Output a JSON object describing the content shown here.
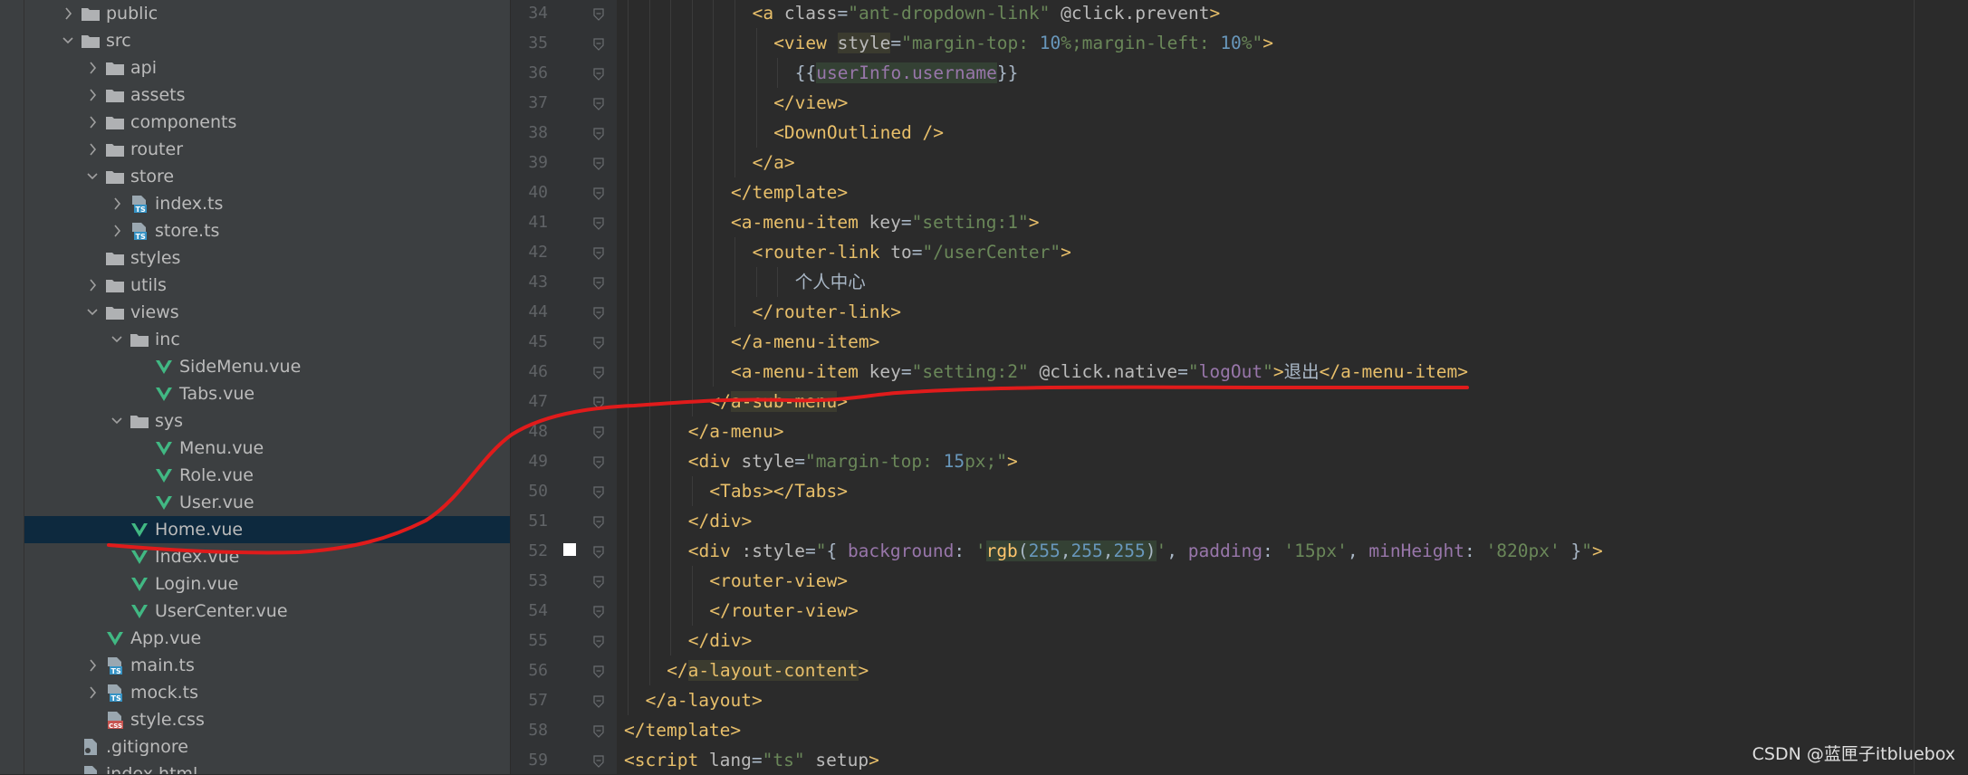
{
  "project_tree": {
    "items": [
      {
        "label": "public",
        "type": "folder",
        "depth": 0,
        "expanded": false,
        "selected": false
      },
      {
        "label": "src",
        "type": "folder",
        "depth": 0,
        "expanded": true,
        "selected": false
      },
      {
        "label": "api",
        "type": "folder",
        "depth": 1,
        "expanded": false,
        "selected": false
      },
      {
        "label": "assets",
        "type": "folder",
        "depth": 1,
        "expanded": false,
        "selected": false
      },
      {
        "label": "components",
        "type": "folder",
        "depth": 1,
        "expanded": false,
        "selected": false
      },
      {
        "label": "router",
        "type": "folder",
        "depth": 1,
        "expanded": false,
        "selected": false
      },
      {
        "label": "store",
        "type": "folder",
        "depth": 1,
        "expanded": true,
        "selected": false
      },
      {
        "label": "index.ts",
        "type": "ts",
        "depth": 2,
        "expanded": false,
        "selected": false
      },
      {
        "label": "store.ts",
        "type": "ts",
        "depth": 2,
        "expanded": false,
        "selected": false
      },
      {
        "label": "styles",
        "type": "folder",
        "depth": 1,
        "expanded": null,
        "selected": false
      },
      {
        "label": "utils",
        "type": "folder",
        "depth": 1,
        "expanded": false,
        "selected": false
      },
      {
        "label": "views",
        "type": "folder",
        "depth": 1,
        "expanded": true,
        "selected": false
      },
      {
        "label": "inc",
        "type": "folder",
        "depth": 2,
        "expanded": true,
        "selected": false
      },
      {
        "label": "SideMenu.vue",
        "type": "vue",
        "depth": 3,
        "expanded": null,
        "selected": false
      },
      {
        "label": "Tabs.vue",
        "type": "vue",
        "depth": 3,
        "expanded": null,
        "selected": false
      },
      {
        "label": "sys",
        "type": "folder",
        "depth": 2,
        "expanded": true,
        "selected": false
      },
      {
        "label": "Menu.vue",
        "type": "vue",
        "depth": 3,
        "expanded": null,
        "selected": false
      },
      {
        "label": "Role.vue",
        "type": "vue",
        "depth": 3,
        "expanded": null,
        "selected": false
      },
      {
        "label": "User.vue",
        "type": "vue",
        "depth": 3,
        "expanded": null,
        "selected": false
      },
      {
        "label": "Home.vue",
        "type": "vue",
        "depth": 2,
        "expanded": null,
        "selected": true
      },
      {
        "label": "Index.vue",
        "type": "vue",
        "depth": 2,
        "expanded": null,
        "selected": false
      },
      {
        "label": "Login.vue",
        "type": "vue",
        "depth": 2,
        "expanded": null,
        "selected": false
      },
      {
        "label": "UserCenter.vue",
        "type": "vue",
        "depth": 2,
        "expanded": null,
        "selected": false
      },
      {
        "label": "App.vue",
        "type": "vue",
        "depth": 1,
        "expanded": null,
        "selected": false
      },
      {
        "label": "main.ts",
        "type": "ts",
        "depth": 1,
        "expanded": false,
        "selected": false
      },
      {
        "label": "mock.ts",
        "type": "ts",
        "depth": 1,
        "expanded": false,
        "selected": false
      },
      {
        "label": "style.css",
        "type": "css",
        "depth": 1,
        "expanded": null,
        "selected": false
      },
      {
        "label": ".gitignore",
        "type": "git",
        "depth": 0,
        "expanded": null,
        "selected": false
      },
      {
        "label": "index.html",
        "type": "html",
        "depth": 0,
        "expanded": null,
        "selected": false
      }
    ]
  },
  "editor": {
    "lines": [
      {
        "n": "34",
        "indent": 6,
        "tokens": [
          [
            "t",
            "<a "
          ],
          [
            "a",
            "class"
          ],
          [
            "p",
            "="
          ],
          [
            "s",
            "\"ant-dropdown-link\""
          ],
          [
            "p",
            " "
          ],
          [
            "a",
            "@click.prevent"
          ],
          [
            "t",
            ">"
          ]
        ]
      },
      {
        "n": "35",
        "indent": 7,
        "tokens": [
          [
            "t",
            "<view "
          ],
          [
            "ah",
            "style"
          ],
          [
            "p",
            "="
          ],
          [
            "s",
            "\"margin-top: "
          ],
          [
            "num",
            "10"
          ],
          [
            "s",
            "%;margin-left: "
          ],
          [
            "num",
            "10"
          ],
          [
            "s",
            "%\""
          ],
          [
            "t",
            ">"
          ]
        ]
      },
      {
        "n": "36",
        "indent": 8,
        "tokens": [
          [
            "p",
            "{{"
          ],
          [
            "var",
            "userInfo.username"
          ],
          [
            "p",
            "}}"
          ]
        ]
      },
      {
        "n": "37",
        "indent": 7,
        "tokens": [
          [
            "t",
            "</view>"
          ]
        ]
      },
      {
        "n": "38",
        "indent": 7,
        "tokens": [
          [
            "t",
            "<DownOutlined />"
          ]
        ]
      },
      {
        "n": "39",
        "indent": 6,
        "tokens": [
          [
            "t",
            "</a>"
          ]
        ]
      },
      {
        "n": "40",
        "indent": 5,
        "tokens": [
          [
            "t",
            "</template>"
          ]
        ]
      },
      {
        "n": "41",
        "indent": 5,
        "tokens": [
          [
            "t",
            "<a-menu-item "
          ],
          [
            "a",
            "key"
          ],
          [
            "p",
            "="
          ],
          [
            "s",
            "\"setting:1\""
          ],
          [
            "t",
            ">"
          ]
        ]
      },
      {
        "n": "42",
        "indent": 6,
        "tokens": [
          [
            "t",
            "<router-link "
          ],
          [
            "a",
            "to"
          ],
          [
            "p",
            "="
          ],
          [
            "s",
            "\"/userCenter\""
          ],
          [
            "t",
            ">"
          ]
        ]
      },
      {
        "n": "43",
        "indent": 8,
        "tokens": [
          [
            "p",
            "个人中心"
          ]
        ]
      },
      {
        "n": "44",
        "indent": 6,
        "tokens": [
          [
            "t",
            "</router-link>"
          ]
        ]
      },
      {
        "n": "45",
        "indent": 5,
        "tokens": [
          [
            "t",
            "</a-menu-item>"
          ]
        ]
      },
      {
        "n": "46",
        "indent": 5,
        "tokens": [
          [
            "t",
            "<a-menu-item "
          ],
          [
            "a",
            "key"
          ],
          [
            "p",
            "="
          ],
          [
            "s",
            "\"setting:2\""
          ],
          [
            "p",
            " "
          ],
          [
            "a",
            "@click.native"
          ],
          [
            "p",
            "="
          ],
          [
            "s",
            "\""
          ],
          [
            "var",
            "logOut"
          ],
          [
            "s",
            "\""
          ],
          [
            "t",
            ">"
          ],
          [
            "p",
            "退出"
          ],
          [
            "t",
            "</a-menu-item>"
          ]
        ]
      },
      {
        "n": "47",
        "indent": 4,
        "tokens": [
          [
            "t",
            "</"
          ],
          [
            "th",
            "a-sub-menu"
          ],
          [
            "t",
            ">"
          ]
        ]
      },
      {
        "n": "48",
        "indent": 3,
        "tokens": [
          [
            "t",
            "</a-menu>"
          ]
        ]
      },
      {
        "n": "49",
        "indent": 3,
        "tokens": [
          [
            "t",
            "<div "
          ],
          [
            "a",
            "style"
          ],
          [
            "p",
            "="
          ],
          [
            "s",
            "\"margin-top: "
          ],
          [
            "num",
            "15"
          ],
          [
            "s",
            "px;\""
          ],
          [
            "t",
            ">"
          ]
        ]
      },
      {
        "n": "50",
        "indent": 4,
        "tokens": [
          [
            "t",
            "<Tabs></Tabs>"
          ]
        ]
      },
      {
        "n": "51",
        "indent": 3,
        "tokens": [
          [
            "t",
            "</div>"
          ]
        ]
      },
      {
        "n": "52",
        "indent": 3,
        "tokens": [
          [
            "t",
            "<div "
          ],
          [
            "a",
            ":style"
          ],
          [
            "p",
            "="
          ],
          [
            "s",
            "\""
          ],
          [
            "p",
            "{ "
          ],
          [
            "var",
            "background"
          ],
          [
            "p",
            ": "
          ],
          [
            "s",
            "'"
          ],
          [
            "fnh",
            "rgb"
          ],
          [
            "ph",
            "("
          ],
          [
            "numh",
            "255"
          ],
          [
            "ph",
            ","
          ],
          [
            "numh",
            "255"
          ],
          [
            "ph",
            ","
          ],
          [
            "numh",
            "255"
          ],
          [
            "ph",
            ")"
          ],
          [
            "s",
            "'"
          ],
          [
            "p",
            ", "
          ],
          [
            "var",
            "padding"
          ],
          [
            "p",
            ": "
          ],
          [
            "s",
            "'15px'"
          ],
          [
            "p",
            ", "
          ],
          [
            "var",
            "minHeight"
          ],
          [
            "p",
            ": "
          ],
          [
            "s",
            "'820px'"
          ],
          [
            "p",
            " }"
          ],
          [
            "s",
            "\""
          ],
          [
            "t",
            ">"
          ]
        ]
      },
      {
        "n": "53",
        "indent": 4,
        "tokens": [
          [
            "t",
            "<router-view>"
          ]
        ]
      },
      {
        "n": "54",
        "indent": 4,
        "tokens": [
          [
            "t",
            "</router-view>"
          ]
        ]
      },
      {
        "n": "55",
        "indent": 3,
        "tokens": [
          [
            "t",
            "</div>"
          ]
        ]
      },
      {
        "n": "56",
        "indent": 2,
        "tokens": [
          [
            "t",
            "</"
          ],
          [
            "th",
            "a-layout-content"
          ],
          [
            "t",
            ">"
          ]
        ]
      },
      {
        "n": "57",
        "indent": 1,
        "tokens": [
          [
            "t",
            "</a-layout>"
          ]
        ]
      },
      {
        "n": "58",
        "indent": 0,
        "tokens": [
          [
            "t",
            "</template>"
          ]
        ]
      },
      {
        "n": "59",
        "indent": 0,
        "tokens": [
          [
            "t",
            "<script "
          ],
          [
            "a",
            "lang"
          ],
          [
            "p",
            "="
          ],
          [
            "s",
            "\"ts\""
          ],
          [
            "p",
            " "
          ],
          [
            "a",
            "setup"
          ],
          [
            "t",
            ">"
          ]
        ]
      }
    ],
    "colors": {
      "t": "#e8bf6a",
      "a": "#bababa",
      "ah": "#bababa",
      "p": "#a9b7c6",
      "ph": "#a9b7c6",
      "s": "#6a8759",
      "num": "#6897bb",
      "numh": "#6897bb",
      "var": "#9876aa",
      "th": "#e8bf6a",
      "fnh": "#ffc66d"
    },
    "highlight_bg": "#344134",
    "tag_highlight_bg": "#3b3b2f"
  },
  "watermark": "CSDN @蓝匣子itbluebox",
  "icons": {
    "folder": "folder-icon",
    "vue": "vue-file-icon",
    "ts": "typescript-file-icon",
    "css": "css-file-icon",
    "git": "gitignore-file-icon",
    "html": "html-file-icon"
  },
  "annotation_color": "#e01b1b"
}
